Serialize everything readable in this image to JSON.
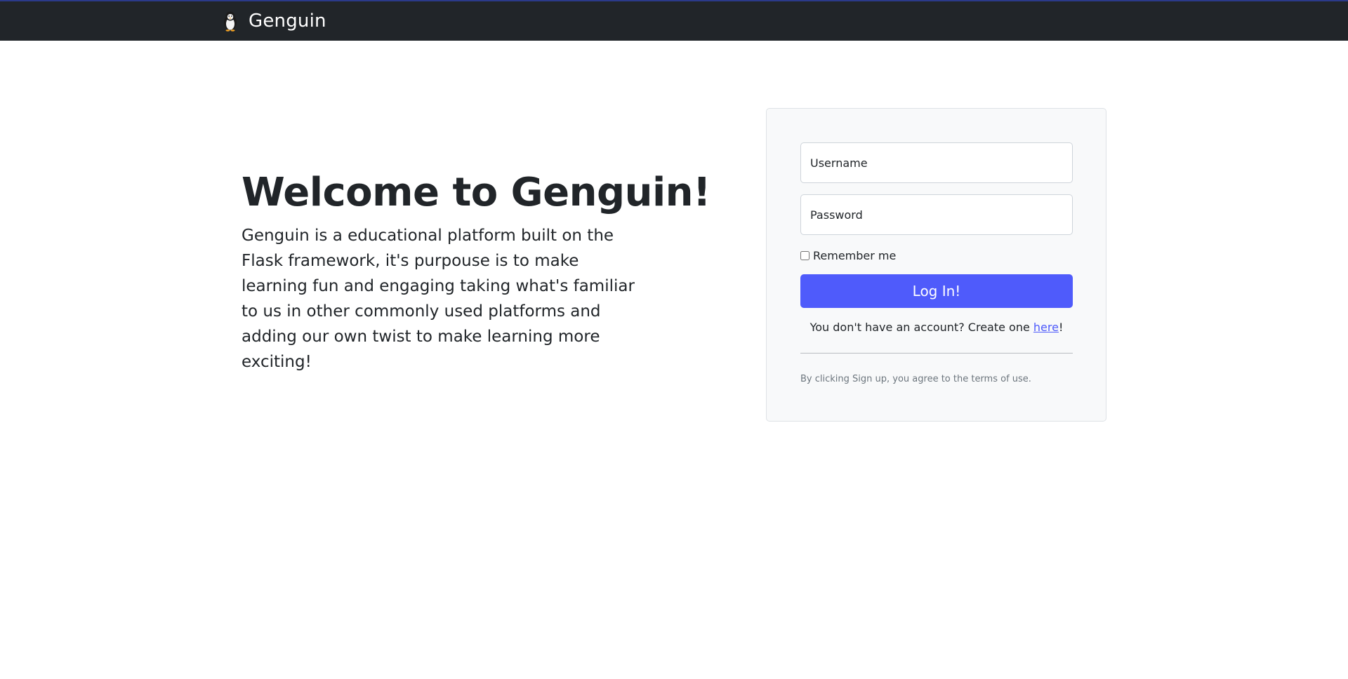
{
  "navbar": {
    "brand_name": "Genguin",
    "logo_icon": "penguin-icon",
    "background": "#212529"
  },
  "hero": {
    "title": "Welcome to Genguin!",
    "description": "Genguin is a educational platform built on the Flask framework, it's purpouse is to make learning fun and engaging taking what's familiar to us in other commonly used platforms and adding our own twist to make learning more exciting!"
  },
  "login_form": {
    "username_placeholder": "Username",
    "username_value": "",
    "password_placeholder": "Password",
    "password_value": "",
    "remember_label": "Remember me",
    "remember_checked": false,
    "submit_label": "Log In!",
    "signup_prefix": "You don't have an account? Create one ",
    "signup_link": "here",
    "signup_suffix": "!",
    "terms_text": "By clicking Sign up, you agree to the terms of use."
  },
  "colors": {
    "accent": "#4f5bfb",
    "card_background": "#f8f9fa",
    "text": "#212529",
    "muted": "#6c757d"
  }
}
